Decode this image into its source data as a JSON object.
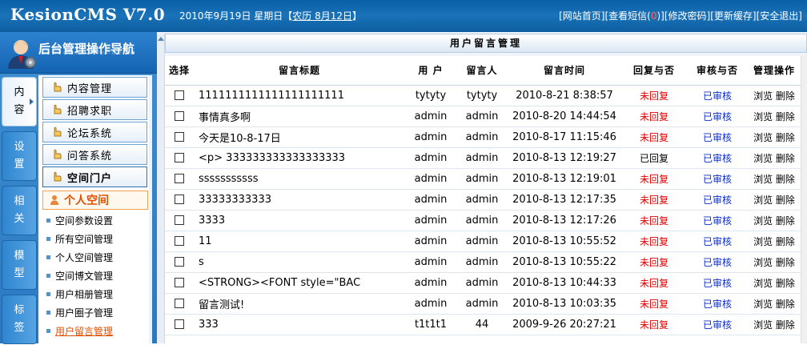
{
  "header": {
    "brand": "KesionCMS V7.0",
    "date_text": "2010年9月19日  星期日【",
    "lunar_text": "农历 8月12日",
    "date_close": "】",
    "links": [
      {
        "label": "[网站首页]"
      },
      {
        "label": "[查看短信(",
        "dot": "0",
        "close": ")]"
      },
      {
        "label": "[修改密码]"
      },
      {
        "label": "[更新缓存]"
      },
      {
        "label": "[安全退出]"
      }
    ]
  },
  "sidebar": {
    "nav_title": "后台管理操作导航",
    "vtabs": [
      "内\n容",
      "设\n置",
      "相\n关",
      "模\n型",
      "标\n签"
    ],
    "menu": [
      "内容管理",
      "招聘求职",
      "论坛系统",
      "问答系统",
      "空间门户"
    ],
    "sub_head": "个人空间",
    "sub_items": [
      "空间参数设置",
      "所有空间管理",
      "个人空间管理",
      "空间博文管理",
      "用户相册管理",
      "用户圈子管理",
      "用户留言管理"
    ]
  },
  "main": {
    "title": "用户留言管理",
    "columns": [
      "选择",
      "留言标题",
      "用 户",
      "留言人",
      "留言时间",
      "回复与否",
      "审核与否",
      "管理操作"
    ],
    "rows": [
      {
        "title": "1111111111111111111111",
        "user": "tytyty",
        "poster": "tytyty",
        "time": "2010-8-21 8:38:57",
        "reply": "未回复",
        "audit": "已审核"
      },
      {
        "title": "事情真多啊",
        "user": "admin",
        "poster": "admin",
        "time": "2010-8-20 14:44:54",
        "reply": "未回复",
        "audit": "已审核"
      },
      {
        "title": "今天是10-8-17日",
        "user": "admin",
        "poster": "admin",
        "time": "2010-8-17 11:15:46",
        "reply": "未回复",
        "audit": "已审核"
      },
      {
        "title": "<p> 333333333333333333",
        "user": "admin",
        "poster": "admin",
        "time": "2010-8-13 12:19:27",
        "reply": "已回复",
        "audit": "已审核"
      },
      {
        "title": "sssssssssss",
        "user": "admin",
        "poster": "admin",
        "time": "2010-8-13 12:19:01",
        "reply": "未回复",
        "audit": "已审核"
      },
      {
        "title": "33333333333",
        "user": "admin",
        "poster": "admin",
        "time": "2010-8-13 12:17:35",
        "reply": "未回复",
        "audit": "已审核"
      },
      {
        "title": "3333",
        "user": "admin",
        "poster": "admin",
        "time": "2010-8-13 12:17:26",
        "reply": "未回复",
        "audit": "已审核"
      },
      {
        "title": "11",
        "user": "admin",
        "poster": "admin",
        "time": "2010-8-13 10:55:52",
        "reply": "未回复",
        "audit": "已审核"
      },
      {
        "title": "s",
        "user": "admin",
        "poster": "admin",
        "time": "2010-8-13 10:55:22",
        "reply": "未回复",
        "audit": "已审核"
      },
      {
        "title": "<STRONG><FONT style=\"BAC",
        "user": "admin",
        "poster": "admin",
        "time": "2010-8-13 10:44:33",
        "reply": "未回复",
        "audit": "已审核"
      },
      {
        "title": "留言测试!",
        "user": "admin",
        "poster": "admin",
        "time": "2010-8-13 10:03:35",
        "reply": "未回复",
        "audit": "已审核"
      },
      {
        "title": "333",
        "user": "t1t1t1",
        "poster": "44",
        "time": "2009-9-26 20:27:21",
        "reply": "未回复",
        "audit": "已审核"
      }
    ],
    "op_view": "浏览",
    "op_delete": "删除"
  }
}
